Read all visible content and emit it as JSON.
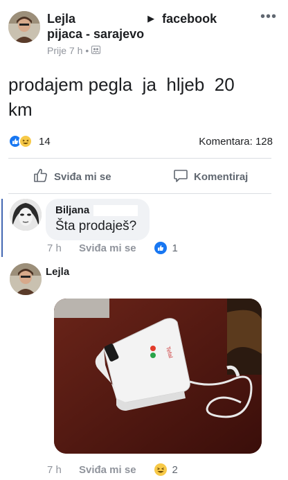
{
  "post": {
    "author": "Lejla",
    "app_label": "facebook",
    "group": "pijaca - sarajevo",
    "time": "Prije 7 h",
    "separator": "•",
    "text": "prodajem pegla  ja  hljeb  20\nkm",
    "reactions_count": "14",
    "comments_count": "Komentara: 128"
  },
  "actions": {
    "like_label": "Sviđa mi se",
    "comment_label": "Komentiraj"
  },
  "comments": [
    {
      "author": "Biljana",
      "text": "Šta prodaješ?",
      "time": "7 h",
      "like_label": "Sviđa mi se",
      "reaction_count": "1"
    },
    {
      "author": "Lejla",
      "time": "7 h",
      "like_label": "Sviđa mi se",
      "reaction_count": "2"
    }
  ],
  "icons": {
    "more": "more-horizontal-icon",
    "arrow": "right-triangle-icon",
    "privacy": "group-privacy-icon",
    "like": "thumbs-up-icon",
    "comment": "comment-bubble-icon",
    "haha": "haha-emoji-icon"
  },
  "colors": {
    "like_blue": "#1877f2",
    "thread_line": "#4267b2",
    "meta_gray": "#90949c",
    "bubble_bg": "#f0f2f5"
  }
}
